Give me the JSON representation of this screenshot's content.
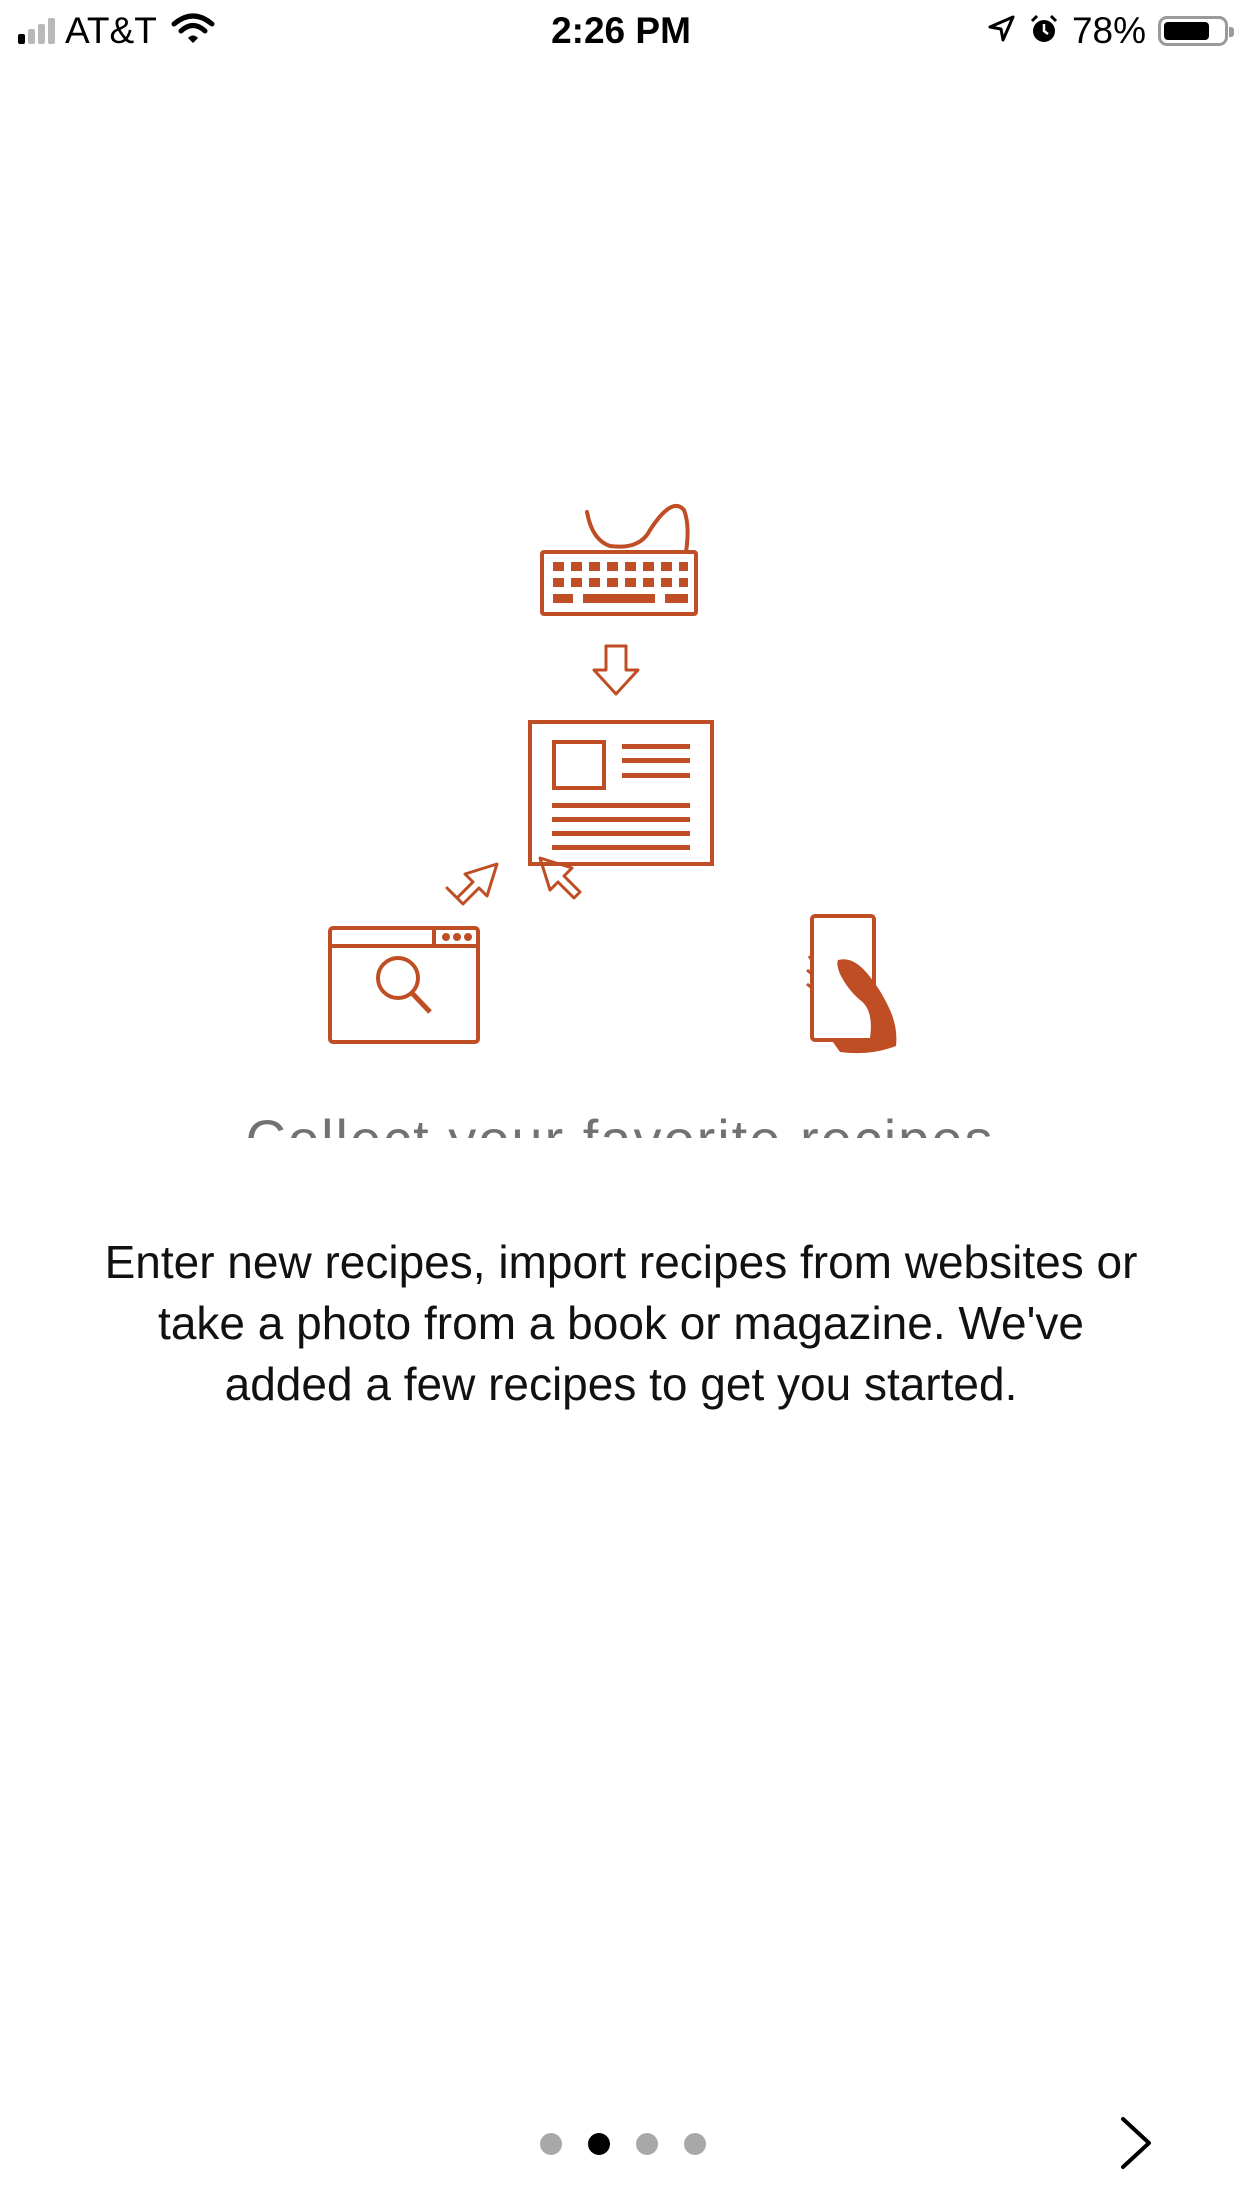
{
  "status_bar": {
    "carrier": "AT&T",
    "time": "2:26 PM",
    "battery_percent": "78%",
    "battery_level": 0.78,
    "signal_bars_on": 1,
    "signal_bars_total": 4,
    "icons": [
      "signal-icon",
      "wifi-icon",
      "location-arrow-icon",
      "alarm-icon",
      "battery-icon"
    ]
  },
  "onboarding": {
    "heading": "Collect your favorite recipes",
    "description": "Enter new recipes, import recipes from websites or take a photo from a book or magazine. We've added a few recipes to get you started.",
    "illustration_icons": [
      "keyboard-icon",
      "arrow-down-icon",
      "recipe-document-icon",
      "arrow-up-right-icon",
      "arrow-up-left-icon",
      "browser-search-icon",
      "hand-phone-icon"
    ],
    "accent_color": "#c04e24"
  },
  "pager": {
    "total_pages": 4,
    "current_page": 2,
    "next_icon": "chevron-right-icon"
  }
}
